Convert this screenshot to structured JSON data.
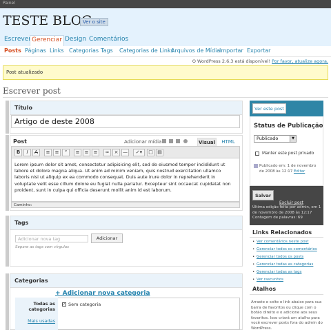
{
  "admin_bar": {
    "label": "Painel"
  },
  "header": {
    "blog_title": "TESTE BLOG",
    "view_site": "Ver o site"
  },
  "main_tabs": [
    {
      "label": "Escrever"
    },
    {
      "label": "Gerenciar",
      "active": true
    },
    {
      "label": "Design"
    },
    {
      "label": "Comentários"
    }
  ],
  "sub_nav": [
    "Posts",
    "Páginas",
    "Links",
    "Categorias",
    "Tags",
    "Categorias de Links",
    "Arquivos de Mídia",
    "Importar",
    "Exportar"
  ],
  "update_nag": {
    "text": "O WordPress 2.6.3 está disponível!",
    "link": "Por favor, atualize agora."
  },
  "notice": "Post atualizado",
  "page_title": "Escrever post",
  "title_box": {
    "label": "Título",
    "value": "Artigo de deste 2008"
  },
  "post_box": {
    "label": "Post",
    "add_media": "Adicionar mídia:",
    "tab_visual": "Visual",
    "tab_html": "HTML",
    "toolbar_icons": [
      "bold-icon",
      "italic-icon",
      "strikethrough-icon",
      "unordered-list-icon",
      "ordered-list-icon",
      "blockquote-icon",
      "align-left-icon",
      "align-center-icon",
      "align-right-icon",
      "link-icon",
      "unlink-icon",
      "more-tag-icon",
      "spellcheck-icon",
      "fullscreen-icon",
      "kitchen-sink-icon"
    ],
    "content": "Lorem ipsum dolor sit amet, consectetur adipisicing elit, sed do eiusmod tempor incididunt ut labore et dolore magna aliqua. Ut enim ad minim veniam, quis nostrud exercitation ullamco laboris nisi ut aliquip ex ea commodo consequat. Duis aute irure dolor in reprehenderit in voluptate velit esse cillum dolore eu fugiat nulla pariatur. Excepteur sint occaecat cupidatat non proident, sunt in culpa qui officia deserunt mollit anim id est laborum.",
    "path": "Caminho:"
  },
  "tags_box": {
    "label": "Tags",
    "placeholder": "Adicionar nova tag",
    "button": "Adicionar",
    "hint": "Separe as tags com vírgulas"
  },
  "categories_box": {
    "label": "Categorias",
    "add_link": "+ Adicionar nova categoria",
    "tab_all": "Todas as categorias",
    "tab_popular": "Mais usadas",
    "items": [
      {
        "label": "Sem categoria",
        "checked": true
      }
    ]
  },
  "sidebar": {
    "view_post": "Ver este post",
    "publish_status_title": "Status de Publicação",
    "status_value": "Publicado",
    "private_label": "Manter este post privado",
    "published_on": "Publicado em: 1 de novembro de 2008 às 12:17",
    "edit_link": "Editar",
    "save": "Salvar",
    "delete": "Excluir post",
    "last_edit": "Última edição feita por admin, em 1 de novembro de 2008 às 12:17",
    "word_count": "Contagem de palavras: 69",
    "related_title": "Links Relacionados",
    "related_links": [
      "Ver comentários neste post",
      "Gerenciar todos os comentários",
      "Gerenciar todos os posts",
      "Gerenciar todas as categorias",
      "Gerenciar todas as tags",
      "Ver rascunhos"
    ],
    "shortcuts_title": "Atalhos",
    "shortcuts_text": "Arraste e solte o link abaixo para sua barra de favoritos ou clique com o botão direito e o adicione aos seus favoritos. Isso criará um atalho para você escrever posts fora do admin do WordPress."
  }
}
